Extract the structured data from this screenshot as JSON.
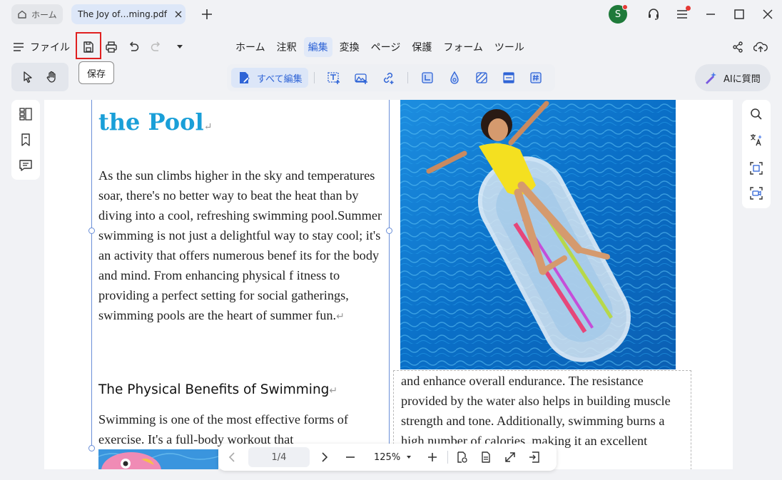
{
  "titlebar": {
    "home_tab": "ホーム",
    "doc_tab": "The Joy of…ming.pdf *",
    "avatar_letter": "S"
  },
  "toolbar": {
    "file_label": "ファイル",
    "menu_tabs": [
      "ホーム",
      "注釈",
      "編集",
      "変換",
      "ページ",
      "保護",
      "フォーム",
      "ツール"
    ],
    "active_tab": "編集",
    "save_tooltip": "保存",
    "edit_all_label": "すべて編集",
    "ai_label": "AIに質問"
  },
  "document": {
    "title": "the Pool",
    "para1": "As the sun climbs higher in the sky and temperatures soar, there's no better way to beat the heat than by diving into a cool, refreshing swimming pool.Summer swimming is not just a delightful way to stay cool; it's an activity that offers numerous benef its for the body and mind. From enhancing physical f itness to providing a perfect setting for social gatherings, swimming pools are the heart of summer fun.",
    "section_heading": "The Physical Benefits of Swimming",
    "para2": "Swimming is one of the most effective forms of exercise. It's a full-body workout that",
    "para3": "and enhance overall endurance. The resistance provided by the water also helps in building muscle strength and tone. Additionally, swimming burns a high number of calories, making it an excellent exercise for"
  },
  "nav": {
    "page_indicator": "1/4",
    "zoom": "125%"
  },
  "colors": {
    "accent": "#2f64d6",
    "title_blue": "#1a9fd8",
    "highlight_red": "#e02020"
  }
}
